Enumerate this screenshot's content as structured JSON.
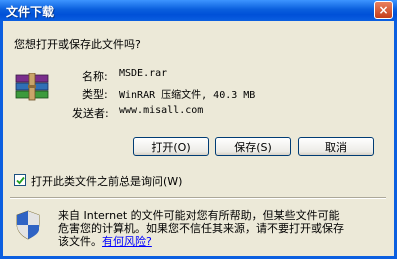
{
  "window": {
    "title": "文件下载",
    "close_label": "×"
  },
  "question": "您想打开或保存此文件吗?",
  "file": {
    "icon": "winrar-archive-icon",
    "name_label": "名称:",
    "name_value": "MSDE.rar",
    "type_label": "类型:",
    "type_value": "WinRAR 压缩文件, 40.3 MB",
    "sender_label": "发送者:",
    "sender_value": "www.misall.com"
  },
  "buttons": {
    "open": "打开(O)",
    "save": "保存(S)",
    "cancel": "取消"
  },
  "checkbox": {
    "label": "打开此类文件之前总是询问(W)",
    "checked": true
  },
  "warning": {
    "icon": "security-shield-icon",
    "line1": "来自 Internet 的文件可能对您有所帮助，但某些文件可能",
    "line2": "危害您的计算机。如果您不信任其来源，请不要打开或保存",
    "line3_prefix": "该文件。",
    "link": "有何风险?"
  },
  "colors": {
    "titlebar": "#0A5FDD",
    "dialog_bg": "#ECE9D8",
    "button_border": "#003C74",
    "link": "#0000FF"
  }
}
